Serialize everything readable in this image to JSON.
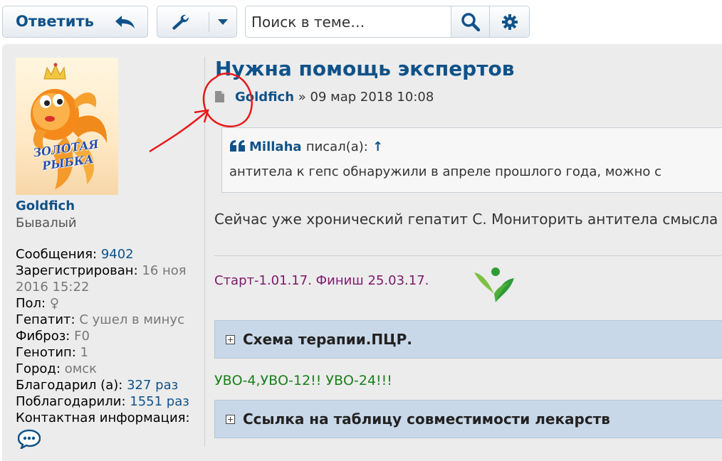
{
  "toolbar": {
    "reply_label": "Ответить",
    "reply_icon": "reply-arrow-icon",
    "tools_icon": "wrench-icon",
    "dropdown_icon": "caret-down-icon",
    "search_placeholder": "Поиск в теме…",
    "search_icon": "search-icon",
    "advanced_search_icon": "gear-icon"
  },
  "profile": {
    "avatar_text_line1": "ЗОЛОТАЯ",
    "avatar_text_line2": "РЫБКА",
    "username": "Goldfich",
    "rank": "Бывалый",
    "fields": {
      "posts_label": "Сообщения:",
      "posts_value": "9402",
      "registered_label": "Зарегистрирован:",
      "registered_value": "16 ноя 2016 15:22",
      "gender_label": "Пол:",
      "gender_value": "♀",
      "hepatitis_label": "Гепатит:",
      "hepatitis_value": "С ушел в минус",
      "fibrosis_label": "Фиброз:",
      "fibrosis_value": "F0",
      "genotype_label": "Генотип:",
      "genotype_value": "1",
      "city_label": "Город:",
      "city_value": "омск",
      "thanked_label": "Благодарил (а):",
      "thanked_value": "327 раз",
      "was_thanked_label": "Поблагодарили:",
      "was_thanked_value": "1551 раз",
      "contact_label": "Контактная информация:"
    },
    "contact_icon": "speech-bubble-icon"
  },
  "post": {
    "title": "Нужна помощь экспертов",
    "post_icon": "document-icon",
    "author": "Goldfich",
    "separator": "»",
    "date": "09 мар 2018 10:08",
    "quote": {
      "icon": "quote-icon",
      "author": "Millaha",
      "wrote": "писал(а):",
      "jump": "↑",
      "text": "антитела к гепс обнаружили в апреле прошлого года, можно с"
    },
    "text": "Сейчас уже хронический гепатит С. Мониторить антитела смысла нет",
    "signature": {
      "line1": "Старт-1.01.17. Финиш 25.03.17.",
      "icon": "green-figure-icon",
      "spoiler1_title": "Схема терапии.ПЦР.",
      "line2": "УВО-4,УВО-12!! УВО-24!!!",
      "spoiler2_title": "Ссылка на таблицу совместимости лекарств",
      "spoiler_icon": "plus-box-icon"
    }
  },
  "colors": {
    "link": "#105289",
    "annotation": "#e8191a",
    "signature_line1": "#7a1a6a",
    "signature_line2": "#1a7f1a",
    "spoiler_bg": "#c9d8e8"
  }
}
